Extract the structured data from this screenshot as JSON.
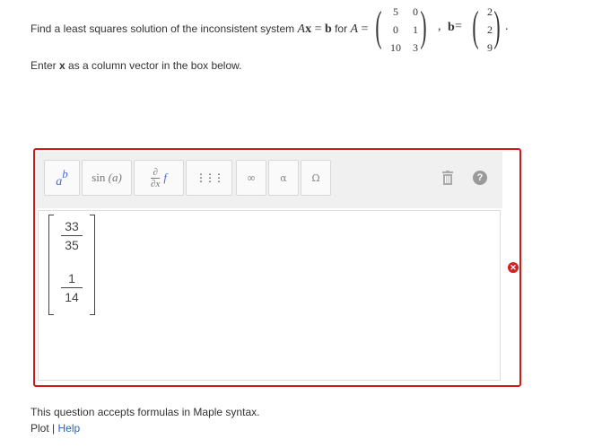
{
  "question": {
    "prefix": "Find a least squares solution of the inconsistent system ",
    "system_A": "A",
    "system_x": "x",
    "system_eq": " = ",
    "system_b": "b",
    "for_text": " for ",
    "A_label": "A",
    "equals": " =",
    "A_matrix": [
      [
        "5",
        "0"
      ],
      [
        "0",
        "1"
      ],
      [
        "10",
        "3"
      ]
    ],
    "comma_b": ", ",
    "b_label": "b",
    "b_equals": " =",
    "b_vector": [
      "2",
      "2",
      "9"
    ],
    "period": "."
  },
  "instruction": {
    "prefix": "Enter ",
    "var": "x",
    "suffix": " as a column vector in the box below."
  },
  "toolbar": {
    "power_base": "a",
    "power_exp": "b",
    "sin_label": "sin",
    "sin_arg": "(a)",
    "deriv_partial": "∂",
    "deriv_var": "∂x",
    "deriv_func": "f",
    "matrix_glyph": "⋮⋮⋮",
    "infinity": "∞",
    "alpha": "α",
    "omega": "Ω",
    "help": "?"
  },
  "answer": {
    "entries": [
      {
        "num": "33",
        "den": "35"
      },
      {
        "num": "1",
        "den": "14"
      }
    ]
  },
  "error_mark": "✕",
  "footer": {
    "note": "This question accepts formulas in Maple syntax.",
    "plot_label": "Plot",
    "separator": " | ",
    "help_label": "Help"
  },
  "colors": {
    "error_border": "#d11a1a",
    "link": "#2a66c0"
  }
}
